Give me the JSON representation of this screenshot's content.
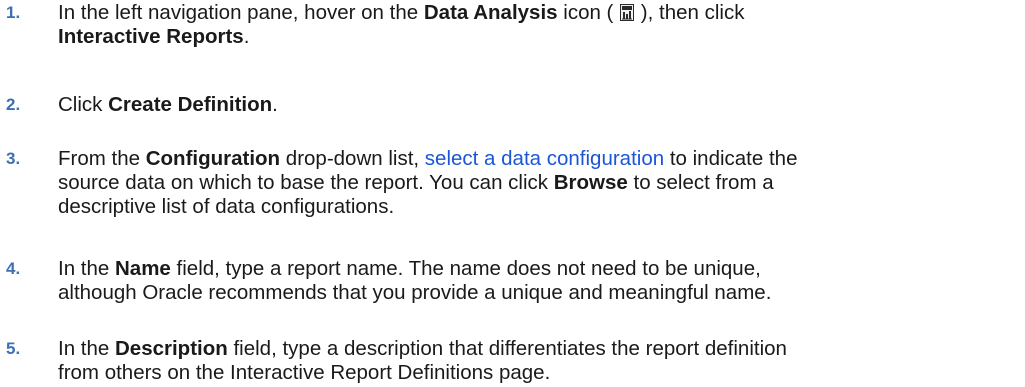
{
  "steps": [
    {
      "number": "1.",
      "line1": {
        "t1": "In the left navigation pane, hover on the ",
        "b1": "Data Analysis",
        "t2": " icon ( ",
        "t3": " ), then click"
      },
      "line2": {
        "b1": "Interactive Reports",
        "t1": "."
      },
      "icon": "data-analysis-icon"
    },
    {
      "number": "2.",
      "line1": {
        "t1": "Click ",
        "b1": "Create Definition",
        "t2": "."
      }
    },
    {
      "number": "3.",
      "line1": {
        "t1": "From the ",
        "b1": "Configuration",
        "t2": " drop-down list, ",
        "link": "select a data configuration",
        "t3": " to indicate the"
      },
      "line2": {
        "t1": "source data on which to base the report. You can click ",
        "b1": "Browse",
        "t2": " to select from a"
      },
      "line3": {
        "t1": "descriptive list of data configurations."
      }
    },
    {
      "number": "4.",
      "line1": {
        "t1": "In the ",
        "b1": "Name",
        "t2": " field, type a report name. The name does not need to be unique,"
      },
      "line2": {
        "t1": "although Oracle recommends that you provide a unique and meaningful name."
      }
    },
    {
      "number": "5.",
      "line1": {
        "t1": "In the ",
        "b1": "Description",
        "t2": " field, type a description that differentiates the report definition"
      },
      "line2": {
        "t1": "from others on the Interactive Report Definitions page."
      }
    }
  ],
  "colors": {
    "number": "#3c6fb4",
    "link": "#1a56d6",
    "text": "#1a1a1a"
  }
}
